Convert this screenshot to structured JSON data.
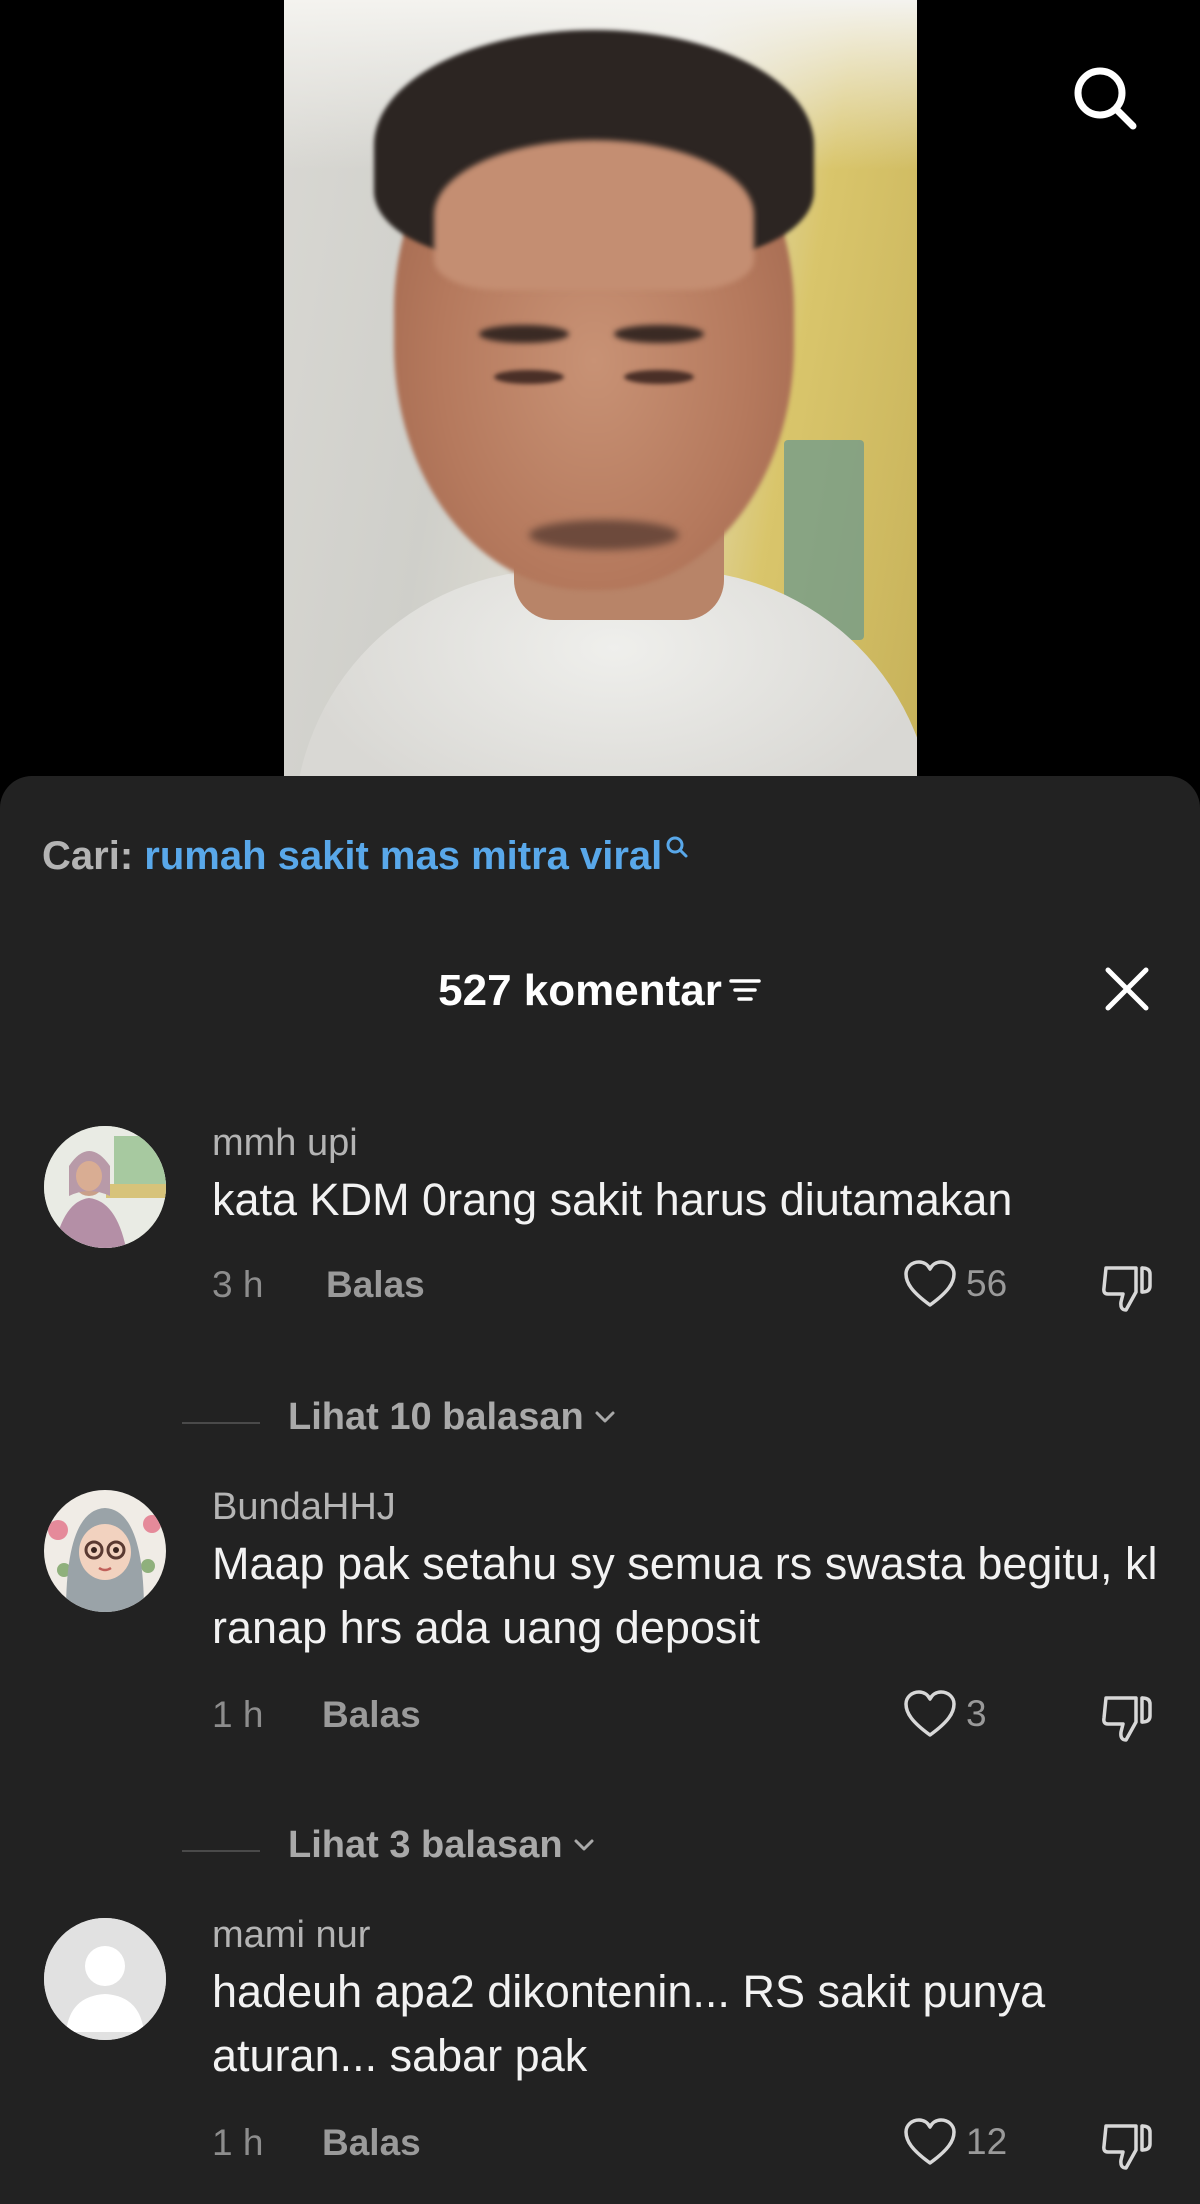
{
  "search_suggestion": {
    "label": "Cari:",
    "query": "rumah sakit mas mitra viral"
  },
  "header": {
    "count_label": "527 komentar"
  },
  "comments": [
    {
      "username": "mmh upi",
      "text": "kata KDM 0rang sakit harus diutamakan",
      "time": "3 h",
      "reply_label": "Balas",
      "likes": "56",
      "view_replies": "Lihat 10 balasan"
    },
    {
      "username": "BundaHHJ",
      "text": "Maap pak setahu sy semua rs swasta begitu, kl ranap hrs ada uang deposit",
      "time": "1 h",
      "reply_label": "Balas",
      "likes": "3",
      "view_replies": "Lihat 3 balasan"
    },
    {
      "username": "mami nur",
      "text": "hadeuh apa2 dikontenin... RS sakit punya aturan... sabar pak",
      "time": "1 h",
      "reply_label": "Balas",
      "likes": "12"
    }
  ],
  "colors": {
    "sheet_bg": "#222222",
    "link_blue": "#59a8ea",
    "muted_text": "#9a9a9a"
  },
  "icons": [
    "search-icon",
    "filter-icon",
    "close-icon",
    "heart-icon",
    "dislike-icon",
    "chevron-down-icon",
    "default-avatar-icon"
  ]
}
